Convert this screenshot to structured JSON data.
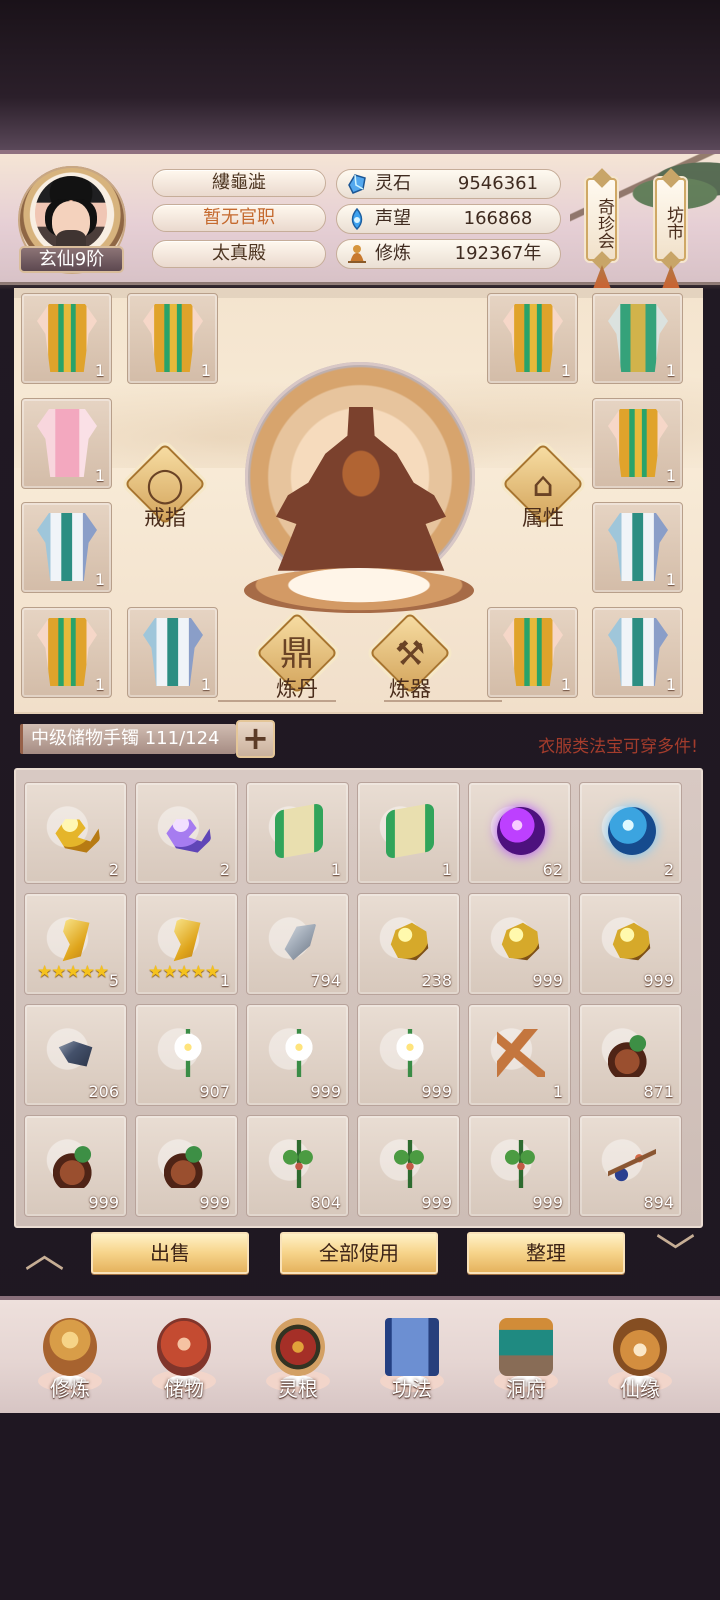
{
  "player": {
    "name": "縷龜澁",
    "title": "暂无官职",
    "sect": "太真殿",
    "rank": "玄仙9阶"
  },
  "resources": [
    {
      "label": "灵石",
      "value": "9546361",
      "icon": "spirit-stone-icon"
    },
    {
      "label": "声望",
      "value": "166868",
      "icon": "reputation-icon"
    },
    {
      "label": "修炼",
      "value": "192367年",
      "icon": "cultivation-icon"
    }
  ],
  "side_tabs": [
    {
      "label": "奇珍会"
    },
    {
      "label": "坊市"
    }
  ],
  "equipment": {
    "slots": [
      {
        "count": "1",
        "icon": "gold-robe-icon"
      },
      {
        "count": "1",
        "icon": "gold-robe-icon"
      },
      {
        "count": "1",
        "icon": "gold-robe-icon"
      },
      {
        "count": "1",
        "icon": "armor-robe-icon"
      },
      {
        "count": "1",
        "icon": "pink-robe-icon"
      },
      {
        "count": "1",
        "icon": "gold-robe-icon"
      },
      {
        "count": "1",
        "icon": "blue-robe-icon"
      },
      {
        "count": "1",
        "icon": "blue-robe-icon"
      },
      {
        "count": "1",
        "icon": "gold-robe-icon"
      },
      {
        "count": "1",
        "icon": "blue-robe-icon"
      },
      {
        "count": "1",
        "icon": "gold-robe-icon"
      },
      {
        "count": "1",
        "icon": "blue-robe-icon"
      }
    ],
    "ring_label": "戒指",
    "attribute_label": "属性",
    "alchemy_label": "炼丹",
    "forge_label": "炼器"
  },
  "bag": {
    "name": "中级储物手镯",
    "capacity": "111/124",
    "hint": "衣服类法宝可穿多件!",
    "plus_label": "+"
  },
  "inventory": [
    {
      "count": "2",
      "icon": "gold-swirl-icon"
    },
    {
      "count": "2",
      "icon": "purple-swirl-icon"
    },
    {
      "count": "1",
      "icon": "scroll-icon"
    },
    {
      "count": "1",
      "icon": "scroll-icon"
    },
    {
      "count": "62",
      "icon": "purple-orb-icon"
    },
    {
      "count": "2",
      "icon": "blue-orb-icon"
    },
    {
      "count": "5",
      "icon": "gold-scroll-icon",
      "stars": "★★★★★"
    },
    {
      "count": "1",
      "icon": "gold-scroll-icon",
      "stars": "★★★★★"
    },
    {
      "count": "794",
      "icon": "silver-ore-icon"
    },
    {
      "count": "238",
      "icon": "gold-ore-icon"
    },
    {
      "count": "999",
      "icon": "gold-ore-icon"
    },
    {
      "count": "999",
      "icon": "gold-ore-icon"
    },
    {
      "count": "206",
      "icon": "dark-ore-icon"
    },
    {
      "count": "907",
      "icon": "white-flower-icon"
    },
    {
      "count": "999",
      "icon": "white-flower-icon"
    },
    {
      "count": "999",
      "icon": "white-flower-icon"
    },
    {
      "count": "1",
      "icon": "ginseng-root-icon"
    },
    {
      "count": "871",
      "icon": "seed-leaf-icon"
    },
    {
      "count": "999",
      "icon": "seed-leaf-icon"
    },
    {
      "count": "999",
      "icon": "seed-leaf-icon"
    },
    {
      "count": "804",
      "icon": "herb-icon"
    },
    {
      "count": "999",
      "icon": "herb-icon"
    },
    {
      "count": "999",
      "icon": "herb-icon"
    },
    {
      "count": "894",
      "icon": "branch-fruit-icon"
    }
  ],
  "actions": {
    "sell": "出售",
    "use_all": "全部使用",
    "sort": "整理",
    "up": "︿",
    "down": "﹀"
  },
  "bottom_nav": [
    {
      "label": "修炼",
      "icon": "cultivation-nav-icon"
    },
    {
      "label": "储物",
      "icon": "storage-nav-icon"
    },
    {
      "label": "灵根",
      "icon": "spirit-root-nav-icon"
    },
    {
      "label": "功法",
      "icon": "skill-book-nav-icon"
    },
    {
      "label": "洞府",
      "icon": "cave-house-nav-icon"
    },
    {
      "label": "仙缘",
      "icon": "immortal-fate-nav-icon"
    }
  ]
}
